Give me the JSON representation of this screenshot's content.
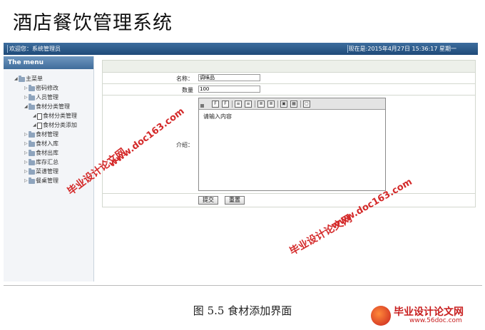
{
  "doc_title": "酒店餐饮管理系统",
  "topbar": {
    "welcome": "欢迎您：系统管理员",
    "now": "现在是:2015年4月27日 15:36:17 星期一"
  },
  "sidebar": {
    "title": "The menu",
    "items": [
      {
        "label": "主菜单"
      },
      {
        "label": "密码修改"
      },
      {
        "label": "人员管理"
      },
      {
        "label": "食材分类管理"
      },
      {
        "label": "食材分类管理"
      },
      {
        "label": "食材分类添加"
      },
      {
        "label": "食材管理"
      },
      {
        "label": "食材入库"
      },
      {
        "label": "食材出库"
      },
      {
        "label": "库存汇总"
      },
      {
        "label": "菜谱管理"
      },
      {
        "label": "餐桌管理"
      }
    ]
  },
  "form": {
    "name_label": "名称：",
    "name_value": "调味品",
    "qty_label": "数量",
    "qty_value": "100",
    "intro_label": "介绍：",
    "editor_text": "请输入内容",
    "submit_label": "提交",
    "reset_label": "重置"
  },
  "caption": "图 5.5  食材添加界面",
  "watermarks": {
    "url": "www.doc163.com",
    "text": "毕业设计论文网"
  },
  "logo": {
    "title": "毕业设计论文网",
    "url": "www.56doc.com"
  },
  "colors": {
    "topbar": "#2c5886",
    "watermark": "#d42a2a"
  }
}
